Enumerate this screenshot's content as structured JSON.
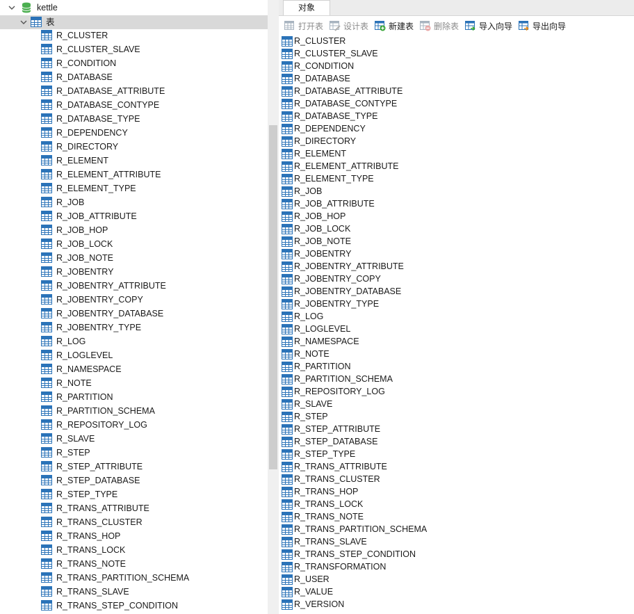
{
  "navigator": {
    "connection_label": "kettle",
    "tables_folder_label": "表",
    "tables": [
      "R_CLUSTER",
      "R_CLUSTER_SLAVE",
      "R_CONDITION",
      "R_DATABASE",
      "R_DATABASE_ATTRIBUTE",
      "R_DATABASE_CONTYPE",
      "R_DATABASE_TYPE",
      "R_DEPENDENCY",
      "R_DIRECTORY",
      "R_ELEMENT",
      "R_ELEMENT_ATTRIBUTE",
      "R_ELEMENT_TYPE",
      "R_JOB",
      "R_JOB_ATTRIBUTE",
      "R_JOB_HOP",
      "R_JOB_LOCK",
      "R_JOB_NOTE",
      "R_JOBENTRY",
      "R_JOBENTRY_ATTRIBUTE",
      "R_JOBENTRY_COPY",
      "R_JOBENTRY_DATABASE",
      "R_JOBENTRY_TYPE",
      "R_LOG",
      "R_LOGLEVEL",
      "R_NAMESPACE",
      "R_NOTE",
      "R_PARTITION",
      "R_PARTITION_SCHEMA",
      "R_REPOSITORY_LOG",
      "R_SLAVE",
      "R_STEP",
      "R_STEP_ATTRIBUTE",
      "R_STEP_DATABASE",
      "R_STEP_TYPE",
      "R_TRANS_ATTRIBUTE",
      "R_TRANS_CLUSTER",
      "R_TRANS_HOP",
      "R_TRANS_LOCK",
      "R_TRANS_NOTE",
      "R_TRANS_PARTITION_SCHEMA",
      "R_TRANS_SLAVE",
      "R_TRANS_STEP_CONDITION"
    ]
  },
  "tab": {
    "objects_label": "对象"
  },
  "toolbar": {
    "open_table": "打开表",
    "design_table": "设计表",
    "new_table": "新建表",
    "delete_table": "删除表",
    "import_wizard": "导入向导",
    "export_wizard": "导出向导"
  },
  "objects": [
    "R_CLUSTER",
    "R_CLUSTER_SLAVE",
    "R_CONDITION",
    "R_DATABASE",
    "R_DATABASE_ATTRIBUTE",
    "R_DATABASE_CONTYPE",
    "R_DATABASE_TYPE",
    "R_DEPENDENCY",
    "R_DIRECTORY",
    "R_ELEMENT",
    "R_ELEMENT_ATTRIBUTE",
    "R_ELEMENT_TYPE",
    "R_JOB",
    "R_JOB_ATTRIBUTE",
    "R_JOB_HOP",
    "R_JOB_LOCK",
    "R_JOB_NOTE",
    "R_JOBENTRY",
    "R_JOBENTRY_ATTRIBUTE",
    "R_JOBENTRY_COPY",
    "R_JOBENTRY_DATABASE",
    "R_JOBENTRY_TYPE",
    "R_LOG",
    "R_LOGLEVEL",
    "R_NAMESPACE",
    "R_NOTE",
    "R_PARTITION",
    "R_PARTITION_SCHEMA",
    "R_REPOSITORY_LOG",
    "R_SLAVE",
    "R_STEP",
    "R_STEP_ATTRIBUTE",
    "R_STEP_DATABASE",
    "R_STEP_TYPE",
    "R_TRANS_ATTRIBUTE",
    "R_TRANS_CLUSTER",
    "R_TRANS_HOP",
    "R_TRANS_LOCK",
    "R_TRANS_NOTE",
    "R_TRANS_PARTITION_SCHEMA",
    "R_TRANS_SLAVE",
    "R_TRANS_STEP_CONDITION",
    "R_TRANSFORMATION",
    "R_USER",
    "R_VALUE",
    "R_VERSION"
  ],
  "colors": {
    "accent": "#2b73b8",
    "selected_row": "#d9d9d9",
    "db_icon": "#4caf50"
  }
}
